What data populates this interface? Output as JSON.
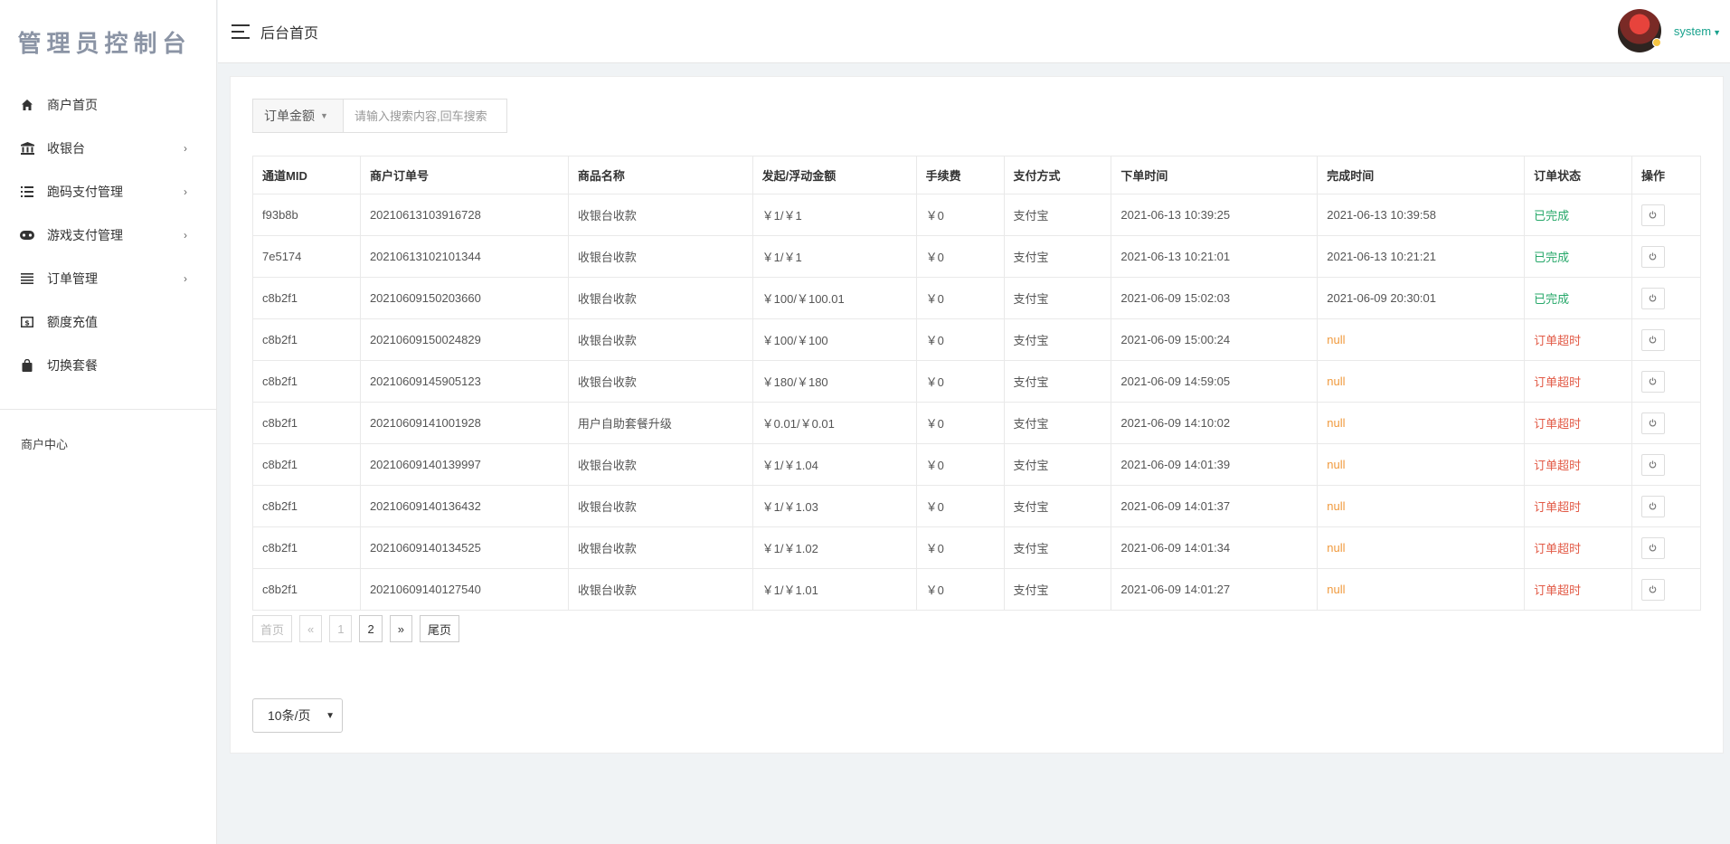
{
  "app": {
    "logo": "管理员控制台"
  },
  "sidebar": {
    "items": [
      {
        "label": "商户首页",
        "icon": "home-icon",
        "chevron": ""
      },
      {
        "label": "收银台",
        "icon": "bank-icon",
        "chevron": "›"
      },
      {
        "label": "跑码支付管理",
        "icon": "list-icon",
        "chevron": "›"
      },
      {
        "label": "游戏支付管理",
        "icon": "gamepad-icon",
        "chevron": "›"
      },
      {
        "label": "订单管理",
        "icon": "lines-icon",
        "chevron": "›"
      },
      {
        "label": "额度充值",
        "icon": "money-icon",
        "chevron": ""
      },
      {
        "label": "切换套餐",
        "icon": "bag-icon",
        "chevron": ""
      }
    ],
    "footer": "商户中心"
  },
  "header": {
    "title": "后台首页",
    "username": "system"
  },
  "search": {
    "field_label": "订单金额",
    "placeholder": "请输入搜索内容,回车搜索"
  },
  "table": {
    "columns": [
      "通道MID",
      "商户订单号",
      "商品名称",
      "发起/浮动金额",
      "手续费",
      "支付方式",
      "下单时间",
      "完成时间",
      "订单状态",
      "操作"
    ],
    "rows": [
      {
        "mid": "f93b8b",
        "order_no": "20210613103916728",
        "product": "收银台收款",
        "amount": "￥1/￥1",
        "fee": "￥0",
        "pay": "支付宝",
        "created": "2021-06-13 10:39:25",
        "finished": "2021-06-13 10:39:58",
        "status": "已完成",
        "status_type": "done"
      },
      {
        "mid": "7e5174",
        "order_no": "20210613102101344",
        "product": "收银台收款",
        "amount": "￥1/￥1",
        "fee": "￥0",
        "pay": "支付宝",
        "created": "2021-06-13 10:21:01",
        "finished": "2021-06-13 10:21:21",
        "status": "已完成",
        "status_type": "done"
      },
      {
        "mid": "c8b2f1",
        "order_no": "20210609150203660",
        "product": "收银台收款",
        "amount": "￥100/￥100.01",
        "fee": "￥0",
        "pay": "支付宝",
        "created": "2021-06-09 15:02:03",
        "finished": "2021-06-09 20:30:01",
        "status": "已完成",
        "status_type": "done"
      },
      {
        "mid": "c8b2f1",
        "order_no": "20210609150024829",
        "product": "收银台收款",
        "amount": "￥100/￥100",
        "fee": "￥0",
        "pay": "支付宝",
        "created": "2021-06-09 15:00:24",
        "finished": "null",
        "status": "订单超时",
        "status_type": "timeout"
      },
      {
        "mid": "c8b2f1",
        "order_no": "20210609145905123",
        "product": "收银台收款",
        "amount": "￥180/￥180",
        "fee": "￥0",
        "pay": "支付宝",
        "created": "2021-06-09 14:59:05",
        "finished": "null",
        "status": "订单超时",
        "status_type": "timeout"
      },
      {
        "mid": "c8b2f1",
        "order_no": "20210609141001928",
        "product": "用户自助套餐升级",
        "amount": "￥0.01/￥0.01",
        "fee": "￥0",
        "pay": "支付宝",
        "created": "2021-06-09 14:10:02",
        "finished": "null",
        "status": "订单超时",
        "status_type": "timeout"
      },
      {
        "mid": "c8b2f1",
        "order_no": "20210609140139997",
        "product": "收银台收款",
        "amount": "￥1/￥1.04",
        "fee": "￥0",
        "pay": "支付宝",
        "created": "2021-06-09 14:01:39",
        "finished": "null",
        "status": "订单超时",
        "status_type": "timeout"
      },
      {
        "mid": "c8b2f1",
        "order_no": "20210609140136432",
        "product": "收银台收款",
        "amount": "￥1/￥1.03",
        "fee": "￥0",
        "pay": "支付宝",
        "created": "2021-06-09 14:01:37",
        "finished": "null",
        "status": "订单超时",
        "status_type": "timeout"
      },
      {
        "mid": "c8b2f1",
        "order_no": "20210609140134525",
        "product": "收银台收款",
        "amount": "￥1/￥1.02",
        "fee": "￥0",
        "pay": "支付宝",
        "created": "2021-06-09 14:01:34",
        "finished": "null",
        "status": "订单超时",
        "status_type": "timeout"
      },
      {
        "mid": "c8b2f1",
        "order_no": "20210609140127540",
        "product": "收银台收款",
        "amount": "￥1/￥1.01",
        "fee": "￥0",
        "pay": "支付宝",
        "created": "2021-06-09 14:01:27",
        "finished": "null",
        "status": "订单超时",
        "status_type": "timeout"
      }
    ]
  },
  "pagination": {
    "first": "首页",
    "prev": "«",
    "pages": [
      "1",
      "2"
    ],
    "current": "1",
    "next": "»",
    "last": "尾页",
    "page_size": "10条/页"
  },
  "colors": {
    "accent": "#19a28d",
    "done": "#27a86a",
    "timeout": "#e25a46",
    "null": "#f09a3e"
  }
}
